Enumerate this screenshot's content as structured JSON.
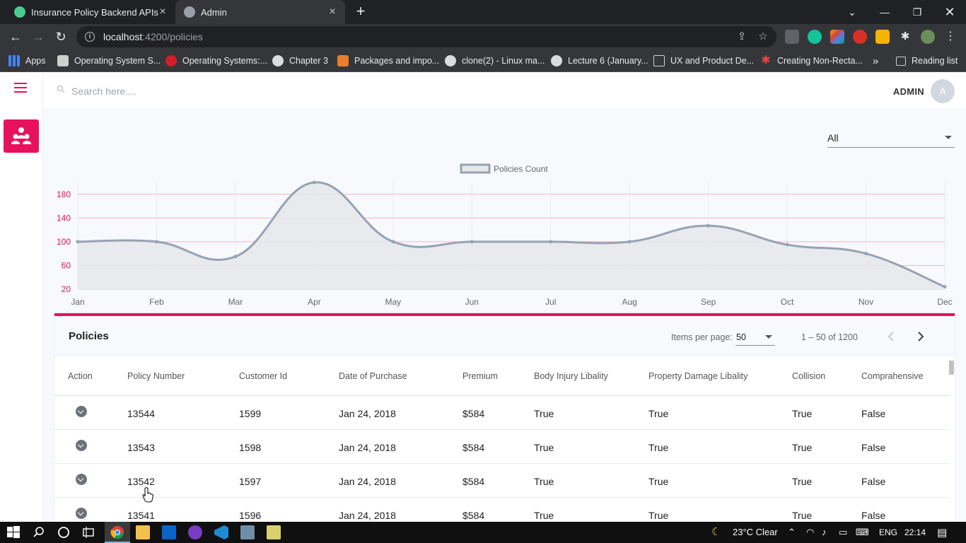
{
  "browser": {
    "tabs": [
      {
        "title": "Insurance Policy Backend APIs",
        "favicon": "green-api-icon",
        "active": false
      },
      {
        "title": "Admin",
        "favicon": "globe-icon",
        "active": true
      }
    ],
    "url_host": "localhost",
    "url_path": ":4200/policies",
    "bookmarks": [
      {
        "label": "Apps",
        "icon": "apps-grid-icon"
      },
      {
        "label": "Operating System S...",
        "icon": "bookmark-site-icon"
      },
      {
        "label": "Operating Systems:...",
        "icon": "red-site-icon"
      },
      {
        "label": "Chapter 3",
        "icon": "globe-icon"
      },
      {
        "label": "Packages and impo...",
        "icon": "orange-site-icon"
      },
      {
        "label": "clone(2) - Linux ma...",
        "icon": "globe-icon"
      },
      {
        "label": "Lecture 6 (January...",
        "icon": "globe-icon"
      },
      {
        "label": "UX and Product De...",
        "icon": "blank-page-icon"
      },
      {
        "label": "Creating Non-Recta...",
        "icon": "red-asterisk-icon"
      }
    ],
    "more_bookmarks": "»",
    "reading_list": "Reading list"
  },
  "app": {
    "search_placeholder": "Search here....",
    "user": {
      "name": "ADMIN",
      "initial": "A"
    },
    "filter": {
      "selected": "All"
    },
    "accent_color": "#e8115b"
  },
  "chart_data": {
    "type": "line",
    "series": [
      {
        "name": "Policies Count",
        "values": [
          100,
          100,
          75,
          200,
          100,
          100,
          100,
          100,
          127,
          95,
          80,
          24
        ]
      }
    ],
    "categories": [
      "Jan",
      "Feb",
      "Mar",
      "Apr",
      "May",
      "Jun",
      "Jul",
      "Aug",
      "Sep",
      "Oct",
      "Nov",
      "Dec"
    ],
    "yticks": [
      "180",
      "140",
      "100",
      "60",
      "20"
    ],
    "ylim": [
      20,
      200
    ],
    "legend_position": "top-center",
    "line_color": "#98a2b3",
    "fill_color": "#e6e8ec",
    "grid_color": "#f4b6c8",
    "tick_color": "#e8115b",
    "smooth": true
  },
  "table": {
    "title": "Policies",
    "items_per_page_label": "Items per page:",
    "items_per_page": "50",
    "range": "1 – 50 of 1200",
    "columns": [
      "Action",
      "Policy Number",
      "Customer Id",
      "Date of Purchase",
      "Premium",
      "Body Injury Libality",
      "Property Damage Libality",
      "Collision",
      "Comprahensive"
    ],
    "rows": [
      [
        "13544",
        "1599",
        "Jan 24, 2018",
        "$584",
        "True",
        "True",
        "True",
        "False"
      ],
      [
        "13543",
        "1598",
        "Jan 24, 2018",
        "$584",
        "True",
        "True",
        "True",
        "False"
      ],
      [
        "13542",
        "1597",
        "Jan 24, 2018",
        "$584",
        "True",
        "True",
        "True",
        "False"
      ],
      [
        "13541",
        "1596",
        "Jan 24, 2018",
        "$584",
        "True",
        "True",
        "True",
        "False"
      ]
    ]
  },
  "taskbar": {
    "weather": "23°C  Clear",
    "language": "ENG",
    "time": "22:14"
  }
}
